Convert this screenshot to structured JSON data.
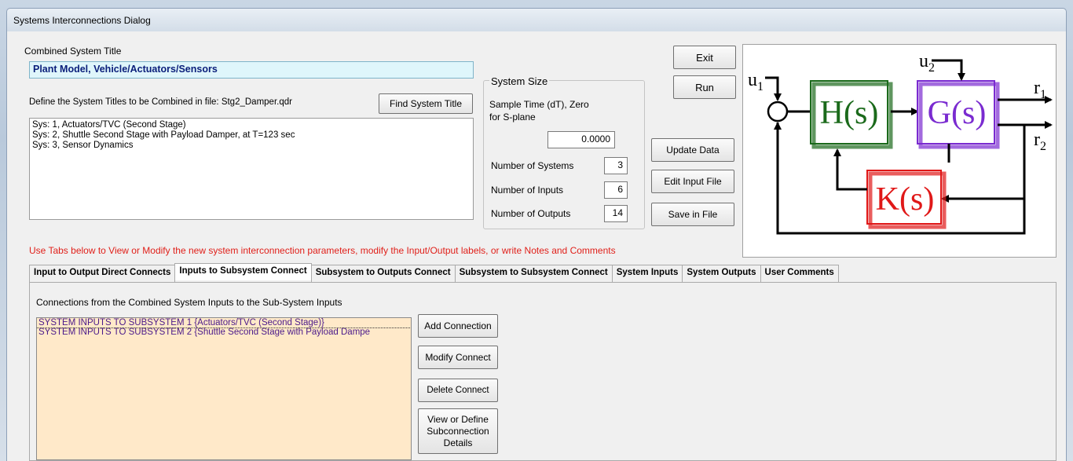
{
  "window": {
    "title": "Systems Interconnections Dialog"
  },
  "combined": {
    "label": "Combined System Title",
    "value": "Plant Model, Vehicle/Actuators/Sensors"
  },
  "define": {
    "label": "Define the System Titles to be Combined in file: Stg2_Damper.qdr",
    "find_button": "Find System Title",
    "lines": [
      "Sys: 1, Actuators/TVC (Second Stage)",
      "Sys: 2, Shuttle Second Stage with Payload Damper, at T=123 sec",
      "Sys: 3, Sensor Dynamics"
    ]
  },
  "system_size": {
    "legend": "System Size",
    "sample_label_1": "Sample Time (dT), Zero",
    "sample_label_2": "for S-plane",
    "sample_value": "0.0000",
    "num_systems_label": "Number of Systems",
    "num_systems": "3",
    "num_inputs_label": "Number of Inputs",
    "num_inputs": "6",
    "num_outputs_label": "Number of Outputs",
    "num_outputs": "14"
  },
  "buttons": {
    "exit": "Exit",
    "run": "Run",
    "update": "Update Data",
    "edit_input": "Edit Input File",
    "save": "Save in File"
  },
  "diagram": {
    "u1": "u",
    "u1_sub": "1",
    "u2": "u",
    "u2_sub": "2",
    "r1": "r",
    "r1_sub": "1",
    "r2": "r",
    "r2_sub": "2",
    "h": "H(s)",
    "g": "G(s)",
    "k": "K(s)",
    "colors": {
      "h": "#1b6a1b",
      "g": "#7a2bd0",
      "k": "#e01818"
    }
  },
  "instruction": "Use Tabs below to View or Modify the new system interconnection parameters, modify the Input/Output labels, or write Notes and Comments",
  "tabs": [
    "Input to Output Direct Connects",
    "Inputs to Subsystem Connect",
    "Subsystem to Outputs Connect",
    "Subsystem to Subsystem Connect",
    "System Inputs",
    "System Outputs",
    "User Comments"
  ],
  "panel": {
    "heading": "Connections from the Combined System Inputs to the Sub-System Inputs",
    "items": [
      "SYSTEM INPUTS TO SUBSYSTEM  1 {Actuators/TVC (Second Stage)}",
      "SYSTEM INPUTS TO SUBSYSTEM  2 {Shuttle Second Stage with Payload Dampe"
    ],
    "add": "Add Connection",
    "modify": "Modify Connect",
    "delete": "Delete Connect",
    "view_1": "View or Define",
    "view_2": "Subconnection",
    "view_3": "Details"
  }
}
